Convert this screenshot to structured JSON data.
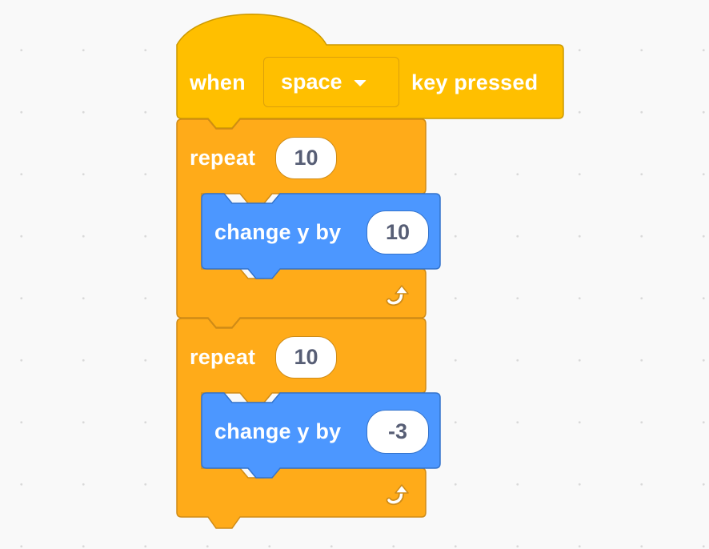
{
  "hat_block": {
    "label_when": "when",
    "key_dropdown": "space",
    "label_key_pressed": "key pressed"
  },
  "loops": [
    {
      "label_repeat": "repeat",
      "count": "10",
      "inner": {
        "label": "change y by",
        "value": "10"
      }
    },
    {
      "label_repeat": "repeat",
      "count": "10",
      "inner": {
        "label": "change y by",
        "value": "-3"
      }
    }
  ],
  "colors": {
    "events": "#ffbf00",
    "events_border": "#cc9900",
    "control": "#ffab19",
    "control_border": "#cf8b17",
    "motion": "#4c97ff",
    "motion_border": "#3373cc",
    "workspace": "#f9f9f9"
  },
  "icons": {
    "loop_arrow": "loop-arrow-icon",
    "dropdown_caret": "chevron-down-icon"
  }
}
